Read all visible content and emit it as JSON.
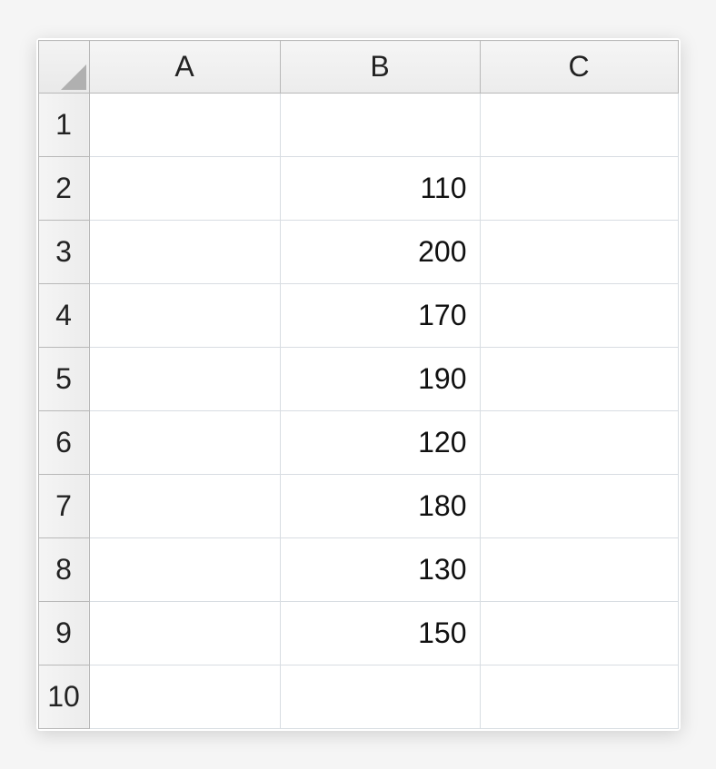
{
  "spreadsheet": {
    "columns": [
      "A",
      "B",
      "C"
    ],
    "rows": [
      {
        "num": "1",
        "A": "",
        "B": "",
        "C": ""
      },
      {
        "num": "2",
        "A": "",
        "B": "110",
        "C": ""
      },
      {
        "num": "3",
        "A": "",
        "B": "200",
        "C": ""
      },
      {
        "num": "4",
        "A": "",
        "B": "170",
        "C": ""
      },
      {
        "num": "5",
        "A": "",
        "B": "190",
        "C": ""
      },
      {
        "num": "6",
        "A": "",
        "B": "120",
        "C": ""
      },
      {
        "num": "7",
        "A": "",
        "B": "180",
        "C": ""
      },
      {
        "num": "8",
        "A": "",
        "B": "130",
        "C": ""
      },
      {
        "num": "9",
        "A": "",
        "B": "150",
        "C": ""
      },
      {
        "num": "10",
        "A": "",
        "B": "",
        "C": ""
      }
    ]
  }
}
